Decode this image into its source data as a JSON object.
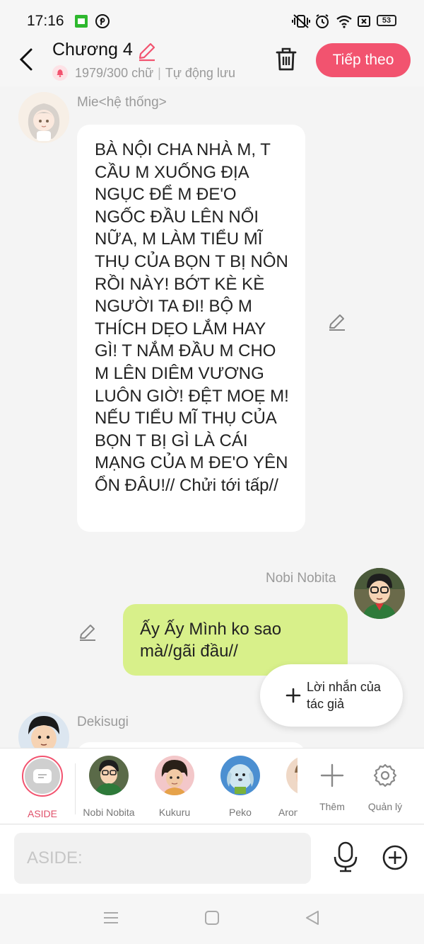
{
  "status": {
    "time": "17:16",
    "battery": "53"
  },
  "header": {
    "title": "Chương 4",
    "counter": "1979/300 chữ",
    "autosave": "Tự động lưu",
    "next_label": "Tiếp theo"
  },
  "messages": [
    {
      "sender": "Mie<hệ thống>",
      "text": "BÀ NỘI CHA NHÀ M, T CẦU M XUỐNG ĐỊA NGỤC ĐỂ M ĐE'O NGỐC ĐẦU LÊN NỔI NỮA, M LÀM TIỂU MĨ THỤ CỦA BỌN T BỊ NÔN RỒI NÀY! BỚT KÈ KÈ NGƯỜI TA ĐI! BỘ M THÍCH DẸO LẮM HAY GÌ! T NẮM ĐẦU M CHO M LÊN DIÊM VƯƠNG LUÔN GIỜ! ĐỆT MOẸ M! NẾU TIỂU MĨ THỤ CỦA BỌN T BỊ GÌ LÀ CÁI MẠNG CỦA M ĐE'O YÊN ỔN ĐÂU!// Chửi tới tấp//"
    },
    {
      "sender": "Nobi Nobita",
      "text": "Ấy Ấy Mình ko sao mà//gãi đầu//"
    },
    {
      "sender": "Dekisugi",
      "text": ""
    }
  ],
  "author_note": {
    "label": "Lời nhắn của tác giả"
  },
  "characters": [
    {
      "name": "ASIDE"
    },
    {
      "name": "Nobi Nobita"
    },
    {
      "name": "Kukuru"
    },
    {
      "name": "Peko"
    },
    {
      "name": "Aron"
    }
  ],
  "actions": {
    "add": "Thêm",
    "manage": "Quản lý"
  },
  "input": {
    "placeholder": "ASIDE:"
  },
  "colors": {
    "accent": "#f2536f",
    "user_bubble": "#d8f08a"
  }
}
